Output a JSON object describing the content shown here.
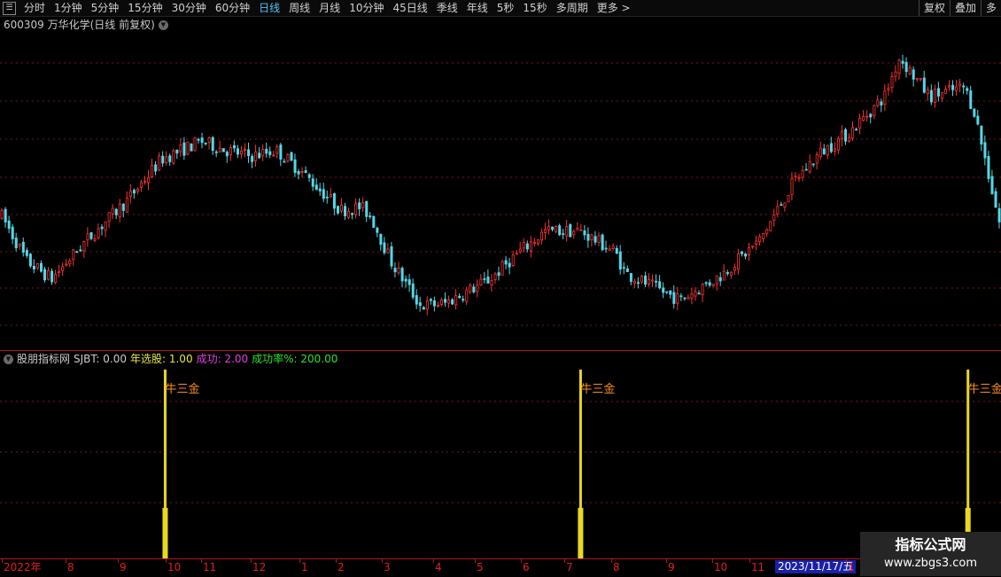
{
  "toolbar": {
    "menu_icon": "grid-menu-icon",
    "periods": [
      {
        "label": "分时",
        "active": false
      },
      {
        "label": "1分钟",
        "active": false
      },
      {
        "label": "5分钟",
        "active": false
      },
      {
        "label": "15分钟",
        "active": false
      },
      {
        "label": "30分钟",
        "active": false
      },
      {
        "label": "60分钟",
        "active": false
      },
      {
        "label": "日线",
        "active": true
      },
      {
        "label": "周线",
        "active": false
      },
      {
        "label": "月线",
        "active": false
      },
      {
        "label": "10分钟",
        "active": false
      },
      {
        "label": "45日线",
        "active": false
      },
      {
        "label": "季线",
        "active": false
      },
      {
        "label": "年线",
        "active": false
      },
      {
        "label": "5秒",
        "active": false
      },
      {
        "label": "15秒",
        "active": false
      },
      {
        "label": "多周期",
        "active": false
      }
    ],
    "more_label": "更多 >",
    "right_buttons": [
      "复权",
      "叠加",
      "多"
    ]
  },
  "main": {
    "title": "600309 万华化学(日线 前复权)",
    "dropdown_icon": "chevron-down-icon"
  },
  "indicator": {
    "name": "股朋指标网",
    "sjbt": "SJBT: 0.00",
    "nianxuangu": "年选股: 1.00",
    "chenggong": "成功: 2.00",
    "chenggonglv": "成功率%: 200.00",
    "signal_label": "牛三金"
  },
  "xaxis": {
    "labels": [
      "2022年",
      "8",
      "9",
      "10",
      "11",
      "12",
      "1",
      "2",
      "3",
      "4",
      "5",
      "6",
      "7",
      "8",
      "9",
      "10",
      "11",
      "1"
    ],
    "cursor_date": "2023/11/17/五"
  },
  "watermark": {
    "line1": "指标公式网",
    "line2": "www.zbgs3.com"
  },
  "colors": {
    "up": "#ff3232",
    "down": "#54d8e8",
    "grid": "#7a1a1a",
    "signal": "#e8d820",
    "signal_label": "#ff8c1a",
    "sjbt": "#cccccc",
    "nianxuangu": "#e8e840",
    "chenggong": "#e040e0",
    "chenggonglv": "#30e030"
  },
  "chart_data": {
    "type": "candlestick",
    "series": [
      {
        "values": [
          [
            0.0,
            0.4
          ],
          [
            0.025,
            0.25
          ],
          [
            0.05,
            0.19
          ],
          [
            0.085,
            0.32
          ],
          [
            0.125,
            0.45
          ],
          [
            0.16,
            0.59
          ],
          [
            0.2,
            0.65
          ],
          [
            0.225,
            0.62
          ],
          [
            0.25,
            0.6
          ],
          [
            0.275,
            0.62
          ],
          [
            0.3,
            0.55
          ],
          [
            0.34,
            0.42
          ],
          [
            0.36,
            0.43
          ],
          [
            0.37,
            0.4
          ],
          [
            0.39,
            0.25
          ],
          [
            0.42,
            0.1
          ],
          [
            0.445,
            0.11
          ],
          [
            0.49,
            0.19
          ],
          [
            0.515,
            0.27
          ],
          [
            0.545,
            0.35
          ],
          [
            0.58,
            0.35
          ],
          [
            0.615,
            0.28
          ],
          [
            0.625,
            0.21
          ],
          [
            0.68,
            0.12
          ],
          [
            0.72,
            0.2
          ],
          [
            0.76,
            0.32
          ],
          [
            0.795,
            0.52
          ],
          [
            0.82,
            0.61
          ],
          [
            0.85,
            0.68
          ],
          [
            0.885,
            0.8
          ],
          [
            0.9,
            0.93
          ],
          [
            0.93,
            0.8
          ],
          [
            0.965,
            0.83
          ],
          [
            0.975,
            0.75
          ],
          [
            1.0,
            0.38
          ]
        ]
      }
    ],
    "signals_at": [
      0.165,
      0.58,
      0.967
    ]
  }
}
